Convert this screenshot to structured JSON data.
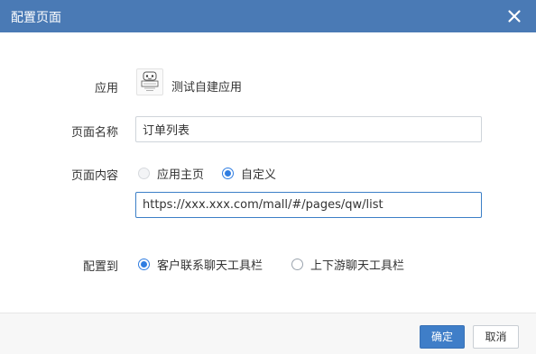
{
  "dialog": {
    "title": "配置页面",
    "close_icon": "close-icon"
  },
  "form": {
    "app": {
      "label": "应用",
      "name": "测试自建应用",
      "icon": "app-logo-icon"
    },
    "page_name": {
      "label": "页面名称",
      "value": "订单列表"
    },
    "page_content": {
      "label": "页面内容",
      "options": [
        {
          "label": "应用主页",
          "checked": false,
          "disabled": true
        },
        {
          "label": "自定义",
          "checked": true,
          "disabled": false
        }
      ],
      "url_value": "https://xxx.xxx.com/mall/#/pages/qw/list"
    },
    "config_to": {
      "label": "配置到",
      "options": [
        {
          "label": "客户联系聊天工具栏",
          "checked": true
        },
        {
          "label": "上下游聊天工具栏",
          "checked": false
        }
      ]
    }
  },
  "footer": {
    "confirm_label": "确定",
    "cancel_label": "取消"
  },
  "colors": {
    "titlebar": "#4a7ab5",
    "primary_button": "#3f7ec8",
    "radio_checked": "#2f7de1",
    "input_focus_border": "#3c7fc7"
  }
}
